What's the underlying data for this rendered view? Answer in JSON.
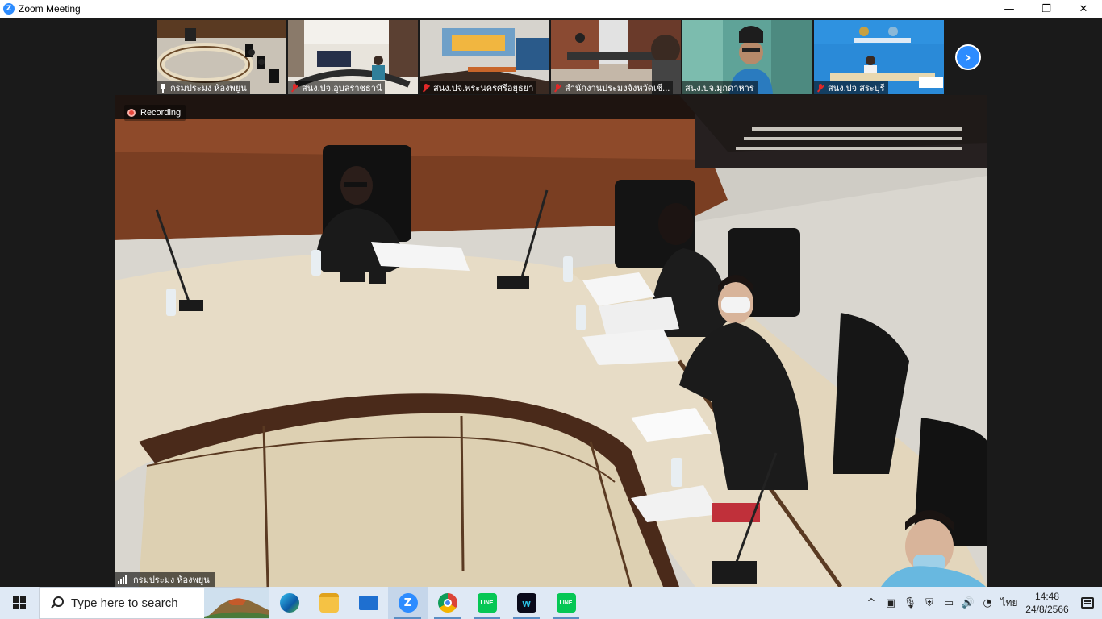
{
  "window": {
    "title": "Zoom Meeting",
    "minimize": "—",
    "restore": "❐",
    "close": "✕"
  },
  "thumbnails": [
    {
      "name": "กรมประมง ห้องพยูน",
      "mic": "pinned"
    },
    {
      "name": "สนง.ปจ.อุบลราชธานี",
      "mic": "muted"
    },
    {
      "name": "สนง.ปจ.พระนครศรีอยุธยา",
      "mic": "muted"
    },
    {
      "name": "สำนักงานประมงจังหวัดเชี...",
      "mic": "muted"
    },
    {
      "name": "สนง.ปจ.มุกดาหาร",
      "mic": "none"
    },
    {
      "name": "สนง.ปจ สระบุรี",
      "mic": "muted"
    }
  ],
  "next_page": "›",
  "main_video": {
    "recording_label": "Recording",
    "speaker_name": "กรมประมง ห้องพยูน"
  },
  "taskbar": {
    "search_placeholder": "Type here to search",
    "apps": [
      "edge-icon",
      "file-explorer-icon",
      "mail-icon",
      "zoom-icon",
      "chrome-icon",
      "line-icon",
      "webex-icon",
      "line-icon"
    ],
    "tray": {
      "chevron": "^",
      "language": "ไทย",
      "time": "14:48",
      "date": "24/8/2566"
    }
  },
  "colors": {
    "zoom_blue": "#2d8cff",
    "active_speaker": "#7ed321",
    "recording_red": "#e8483c",
    "taskbar": "#dfe9f5"
  }
}
